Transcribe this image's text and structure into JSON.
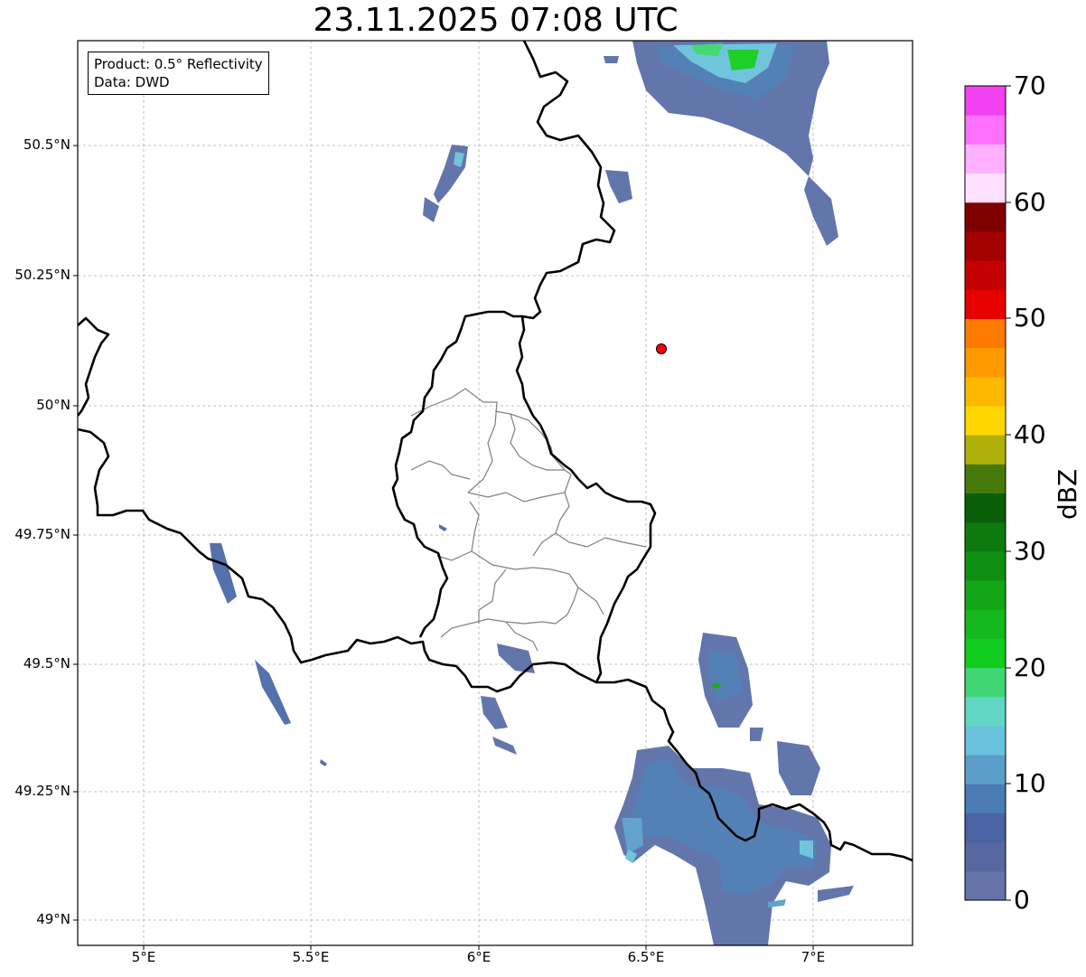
{
  "title": "23.11.2025 07:08 UTC",
  "info_box": {
    "product": "Product: 0.5° Reflectivity",
    "data": "Data: DWD"
  },
  "map": {
    "lon_ticks": [
      "5°E",
      "5.5°E",
      "6°E",
      "6.5°E",
      "7°E"
    ],
    "lat_ticks": [
      "50.5°N",
      "50.25°N",
      "50°N",
      "49.75°N",
      "49.5°N",
      "49.25°N",
      "49°N"
    ],
    "radar_site_color": "#ff0000",
    "border_color": "#000000",
    "district_color": "#808080",
    "grid": "dashed light gray"
  },
  "colorbar": {
    "label": "dBZ",
    "ticks": [
      "0",
      "10",
      "20",
      "30",
      "40",
      "50",
      "60",
      "70"
    ],
    "colors": [
      "#6474a8",
      "#56689f",
      "#4a63a4",
      "#4a7bb3",
      "#5a9ec9",
      "#69c2dc",
      "#62d6c4",
      "#40d674",
      "#12cc1e",
      "#14b81c",
      "#12a516",
      "#0f8f12",
      "#0c7a0f",
      "#0a5e0a",
      "#457a0a",
      "#b0b00a",
      "#ffd700",
      "#ffb800",
      "#ff9a00",
      "#ff7a00",
      "#e60000",
      "#c40000",
      "#a20000",
      "#800000",
      "#ffe0ff",
      "#ffb0ff",
      "#ff70ff",
      "#f040f0"
    ]
  }
}
